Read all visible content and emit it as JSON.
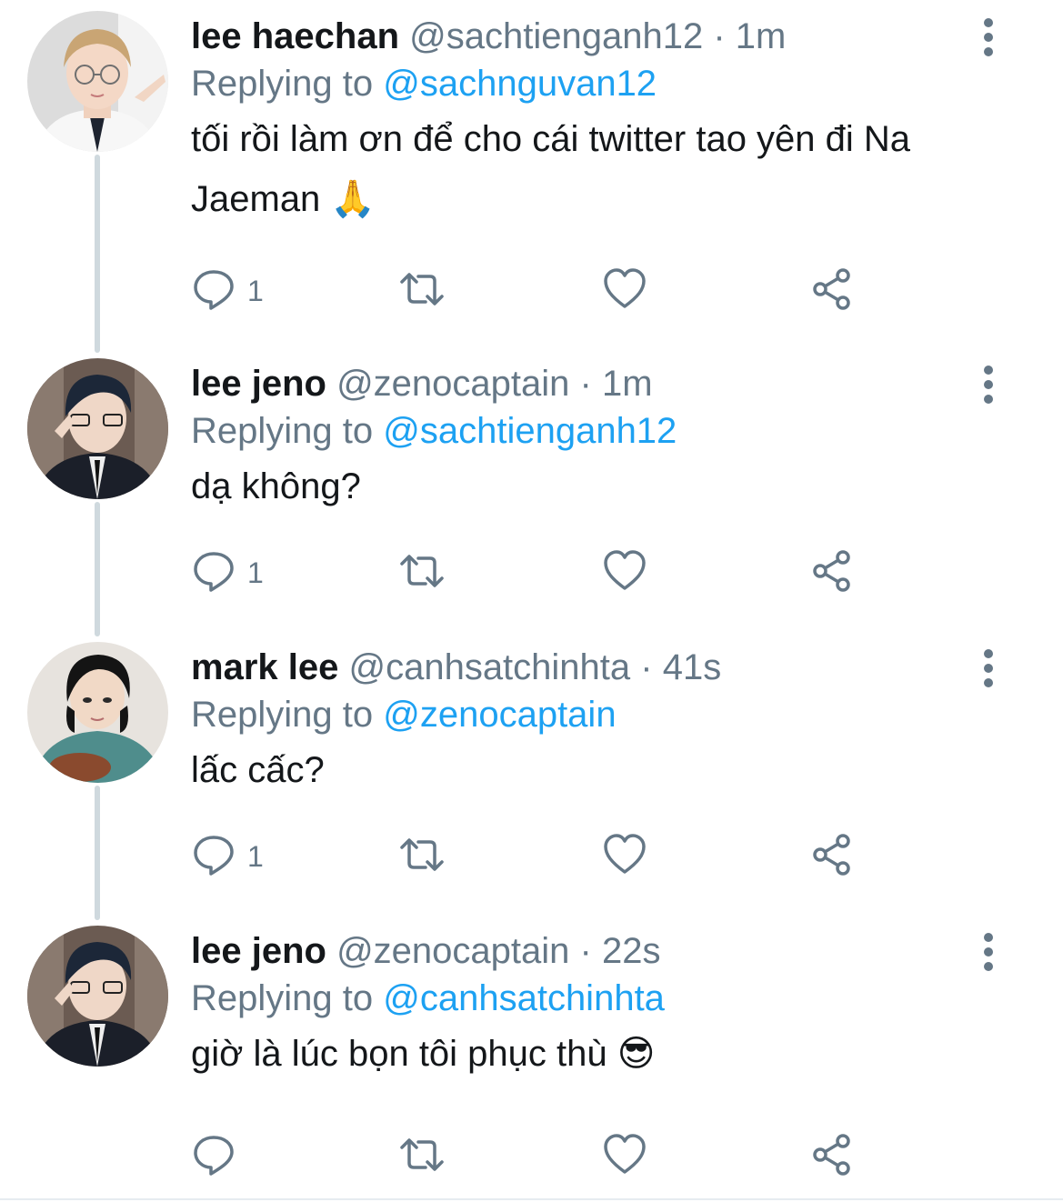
{
  "tweets": [
    {
      "name": "lee haechan",
      "handle": "@sachtienganh12",
      "separator": " · ",
      "time": "1m",
      "replying_prefix": "Replying to ",
      "replying_to": "@sachnguvan12",
      "text": "tối rồi làm ơn để cho cái twitter tao yên đi Na Jaeman 🙏",
      "reply_count": "1"
    },
    {
      "name": "lee jeno",
      "handle": "@zenocaptain",
      "separator": " · ",
      "time": "1m",
      "replying_prefix": "Replying to ",
      "replying_to": "@sachtienganh12",
      "text": "dạ không?",
      "reply_count": "1"
    },
    {
      "name": "mark lee",
      "handle": "@canhsatchinhta",
      "separator": " · ",
      "time": "41s",
      "replying_prefix": "Replying to ",
      "replying_to": "@zenocaptain",
      "text": "lấc cấc?",
      "reply_count": "1"
    },
    {
      "name": "lee jeno",
      "handle": "@zenocaptain",
      "separator": " · ",
      "time": "22s",
      "replying_prefix": "Replying to ",
      "replying_to": "@canhsatchinhta",
      "text": "giờ là lúc bọn tôi phục thù 😎",
      "reply_count": ""
    }
  ],
  "icons": {
    "reply": "reply-icon",
    "retweet": "retweet-icon",
    "like": "heart-icon",
    "share": "share-icon",
    "more": "more-vertical-icon"
  },
  "colors": {
    "name": "#14171a",
    "meta": "#657786",
    "mention": "#1da1f2",
    "thread_line": "#cfd9de",
    "icon": "#657786"
  }
}
